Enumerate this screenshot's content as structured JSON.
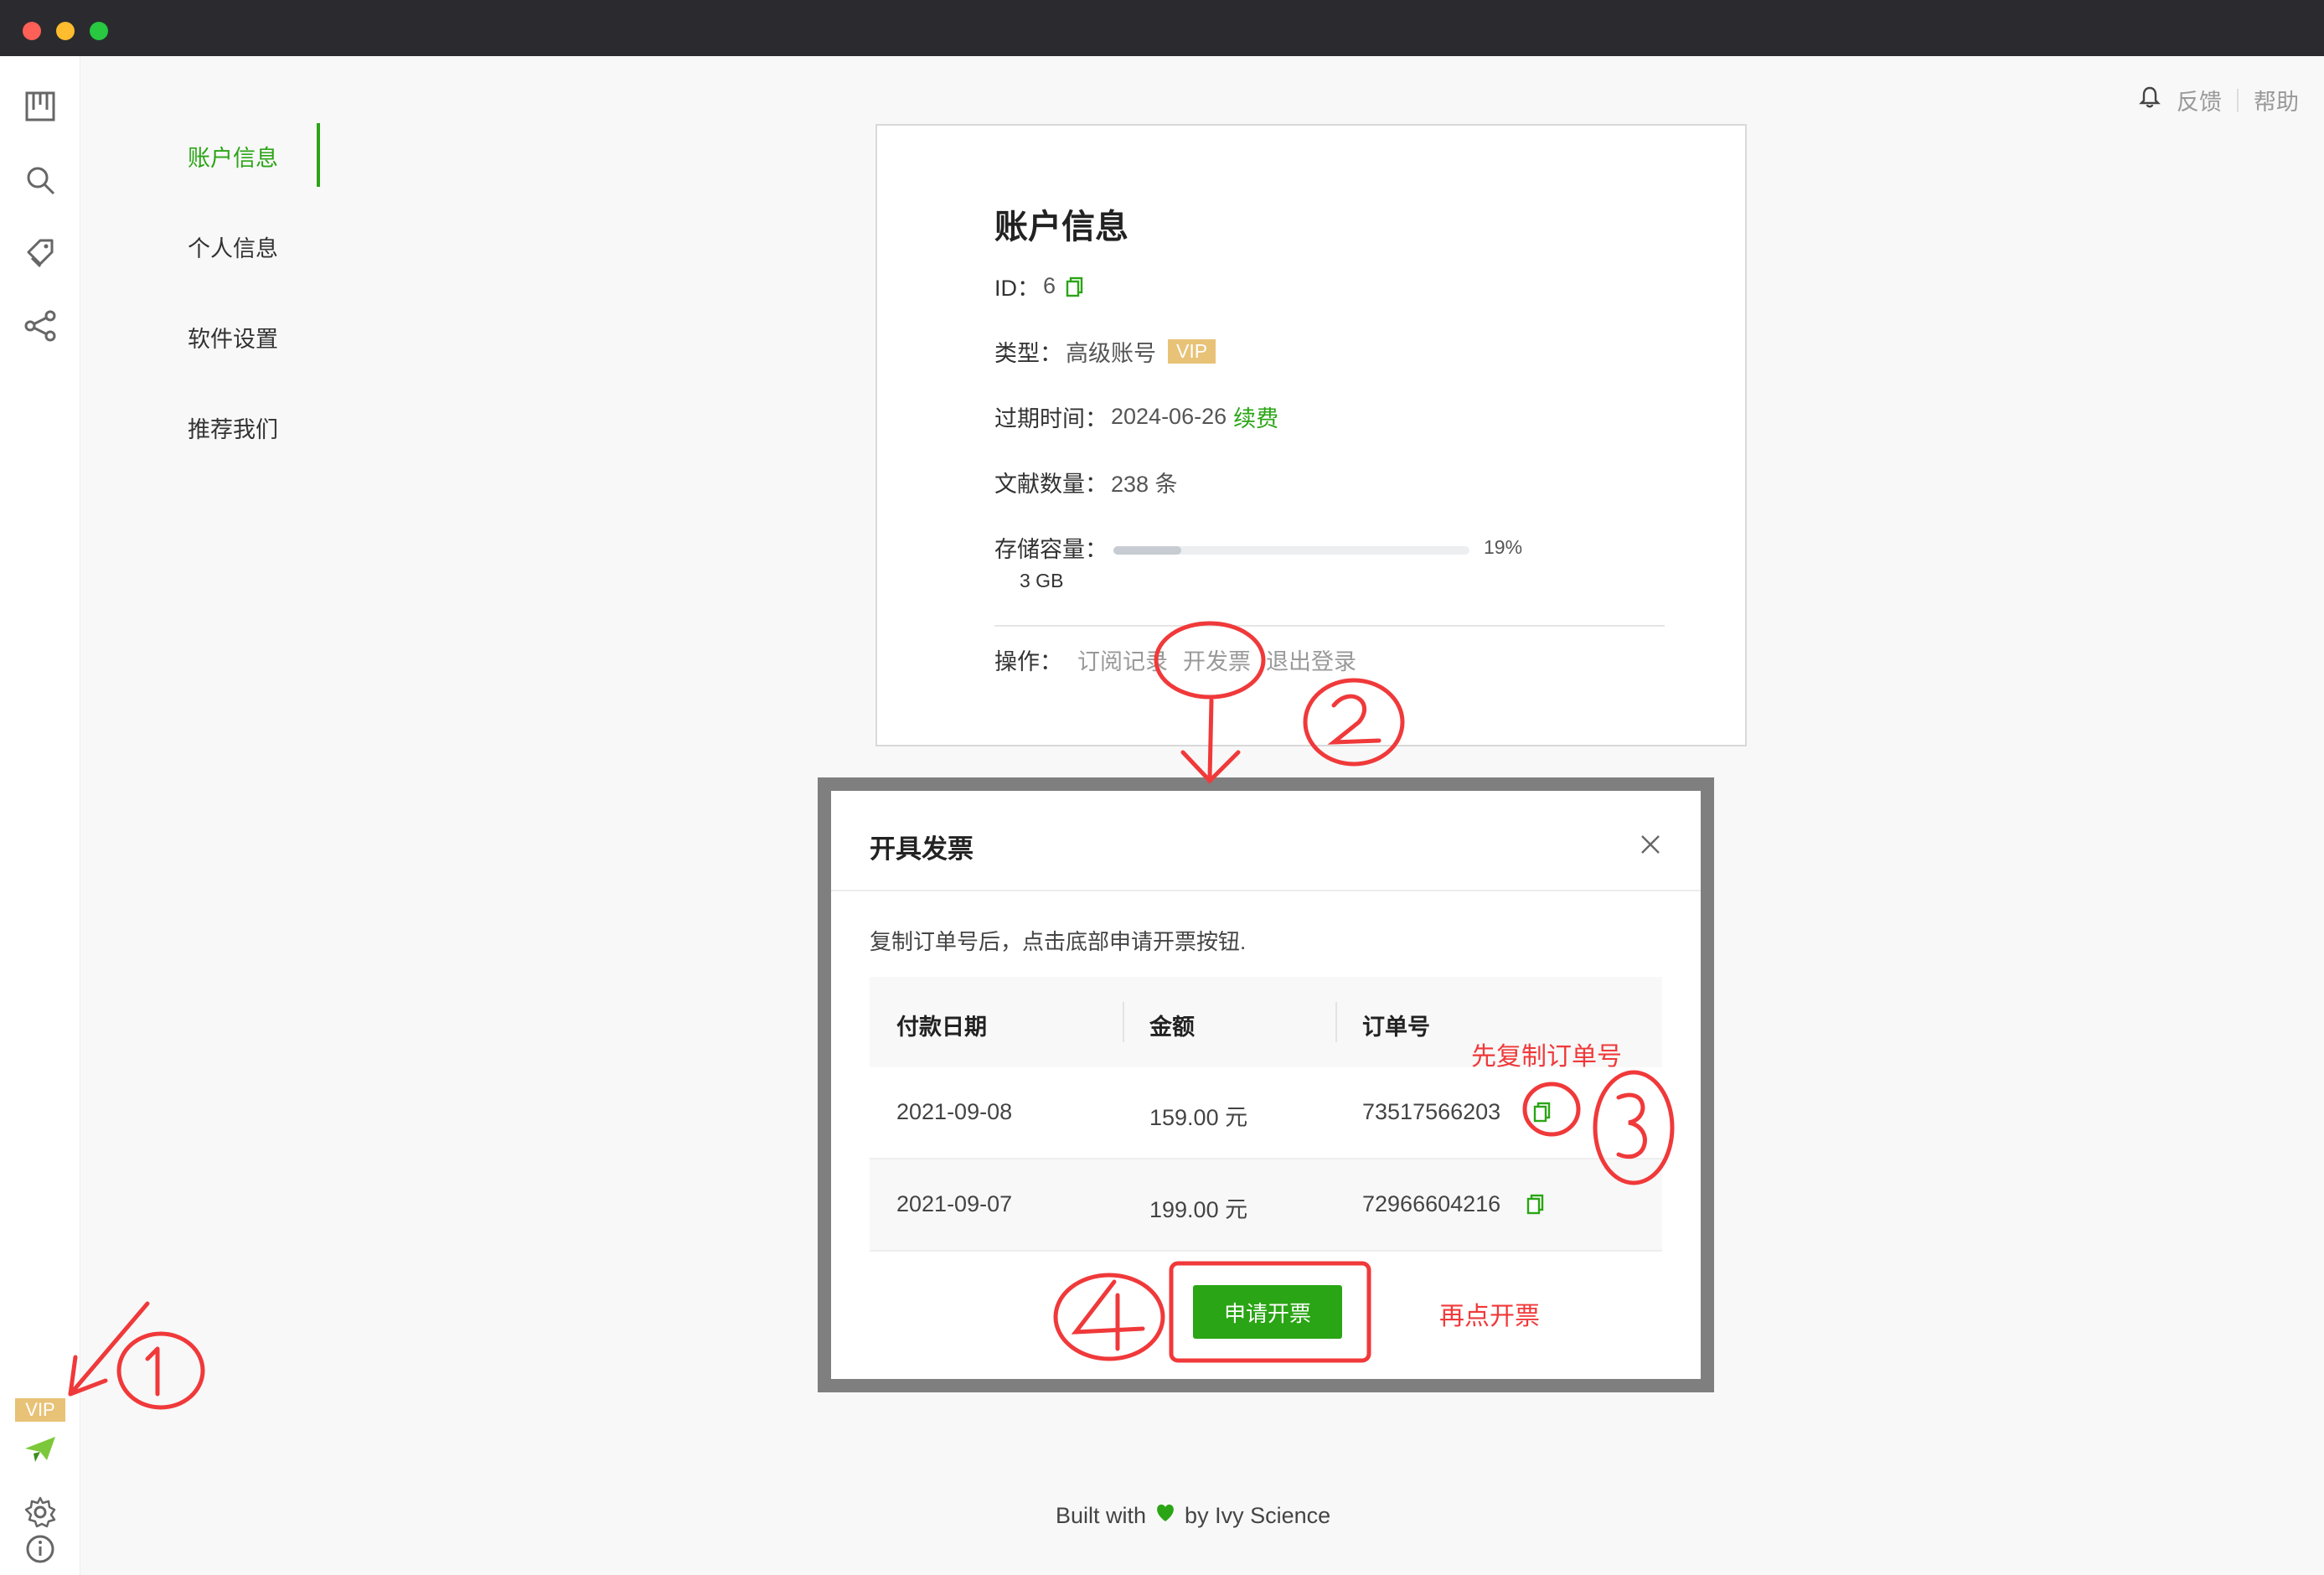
{
  "window": {
    "controls": [
      "close",
      "minimize",
      "maximize"
    ]
  },
  "rail": {
    "icons": [
      "library-icon",
      "search-icon",
      "tag-icon",
      "share-icon"
    ],
    "vip_badge": "VIP",
    "bottom_icons": [
      "vip-plane-icon",
      "gear-icon",
      "info-icon"
    ]
  },
  "nav": {
    "items": [
      {
        "label": "账户信息",
        "active": true
      },
      {
        "label": "个人信息",
        "active": false
      },
      {
        "label": "软件设置",
        "active": false
      },
      {
        "label": "推荐我们",
        "active": false
      }
    ]
  },
  "header": {
    "feedback": "反馈",
    "help": "帮助"
  },
  "account": {
    "title": "账户信息",
    "id_label": "ID：",
    "id_value": "6",
    "type_label": "类型：",
    "type_value": "高级账号",
    "type_badge": "VIP",
    "expire_label": "过期时间：",
    "expire_value": "2024-06-26",
    "renew_link": "续费",
    "docs_label": "文献数量：",
    "docs_value": "238 条",
    "storage_label": "存储容量：",
    "storage_percent": "19%",
    "storage_fraction": 0.19,
    "storage_total": "3 GB",
    "ops_label": "操作：",
    "ops": [
      "订阅记录",
      "开发票",
      "退出登录"
    ]
  },
  "dialog": {
    "title": "开具发票",
    "description": "复制订单号后，点击底部申请开票按钮.",
    "columns": [
      "付款日期",
      "金额",
      "订单号"
    ],
    "rows": [
      {
        "date": "2021-09-08",
        "amount": "159.00 元",
        "order": "73517566203"
      },
      {
        "date": "2021-09-07",
        "amount": "199.00 元",
        "order": "72966604216"
      }
    ],
    "apply_button": "申请开票"
  },
  "annotations": {
    "copy_first": "先复制订单号",
    "then_apply": "再点开票",
    "color": "#f0393a"
  },
  "footer": {
    "prefix": "Built with",
    "suffix": "by Ivy Science"
  },
  "colors": {
    "accent_green": "#2aa515",
    "vip_gold": "#e8c276",
    "titlebar": "#2b2b2f"
  }
}
